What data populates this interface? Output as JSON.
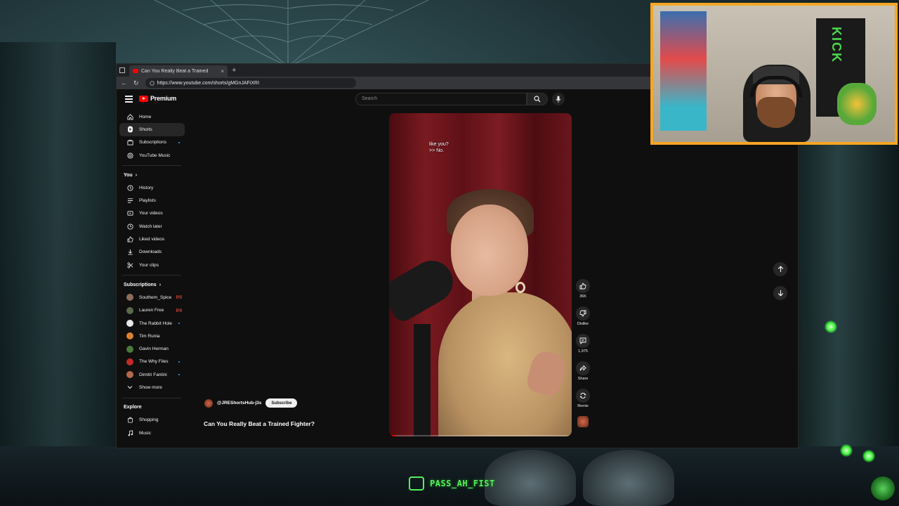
{
  "browser": {
    "tab_title": "Can You Really Beat a Trained",
    "tab_close": "×",
    "new_tab": "+",
    "url": "https://www.youtube.com/shorts/gMGnJAFiXRI"
  },
  "masthead": {
    "logo_text": "Premium",
    "search_placeholder": "Search"
  },
  "sidebar": {
    "main_items": [
      {
        "label": "Home",
        "icon": "home-icon"
      },
      {
        "label": "Shorts",
        "icon": "shorts-icon",
        "active": true
      },
      {
        "label": "Subscriptions",
        "icon": "subscriptions-icon"
      },
      {
        "label": "YouTube Music",
        "icon": "youtube-music-icon"
      }
    ],
    "you_heading": "You",
    "you_items": [
      {
        "label": "History",
        "icon": "history-icon"
      },
      {
        "label": "Playlists",
        "icon": "playlists-icon"
      },
      {
        "label": "Your videos",
        "icon": "your-videos-icon"
      },
      {
        "label": "Watch later",
        "icon": "watch-later-icon"
      },
      {
        "label": "Liked videos",
        "icon": "liked-videos-icon"
      },
      {
        "label": "Downloads",
        "icon": "downloads-icon"
      },
      {
        "label": "Your clips",
        "icon": "clips-icon"
      }
    ],
    "subs_heading": "Subscriptions",
    "subscriptions": [
      {
        "label": "Southern_Spice",
        "color": "#8a6d5a",
        "status": "live"
      },
      {
        "label": "Lauren Free",
        "color": "#5a6a4a",
        "status": "live"
      },
      {
        "label": "The Rabbit Hole",
        "color": "#e8e8e8",
        "status": "new"
      },
      {
        "label": "Tim Runia",
        "color": "#d9822b",
        "status": "none"
      },
      {
        "label": "Gavin Herman",
        "color": "#4a7a3a",
        "status": "none"
      },
      {
        "label": "The Why Files",
        "color": "#c22a2a",
        "status": "new"
      },
      {
        "label": "Dimitri Fantini",
        "color": "#b06a4a",
        "status": "new"
      }
    ],
    "show_more": "Show more",
    "explore_heading": "Explore",
    "explore_items": [
      {
        "label": "Shopping",
        "icon": "shopping-icon"
      },
      {
        "label": "Music",
        "icon": "music-icon"
      }
    ]
  },
  "short": {
    "caption": "like you?\n>> No.",
    "channel": "@JREShortsHub-j3s",
    "subscribe": "Subscribe",
    "title": "Can You Really Beat a Trained Fighter?",
    "progress": 0.04
  },
  "actions": {
    "likes": "36K",
    "dislike": "Dislike",
    "comments": "1,975",
    "share": "Share",
    "remix": "Remix"
  },
  "overlay": {
    "stream_tag": "PASS_AH_FIST",
    "cam_banner": "KICK"
  }
}
